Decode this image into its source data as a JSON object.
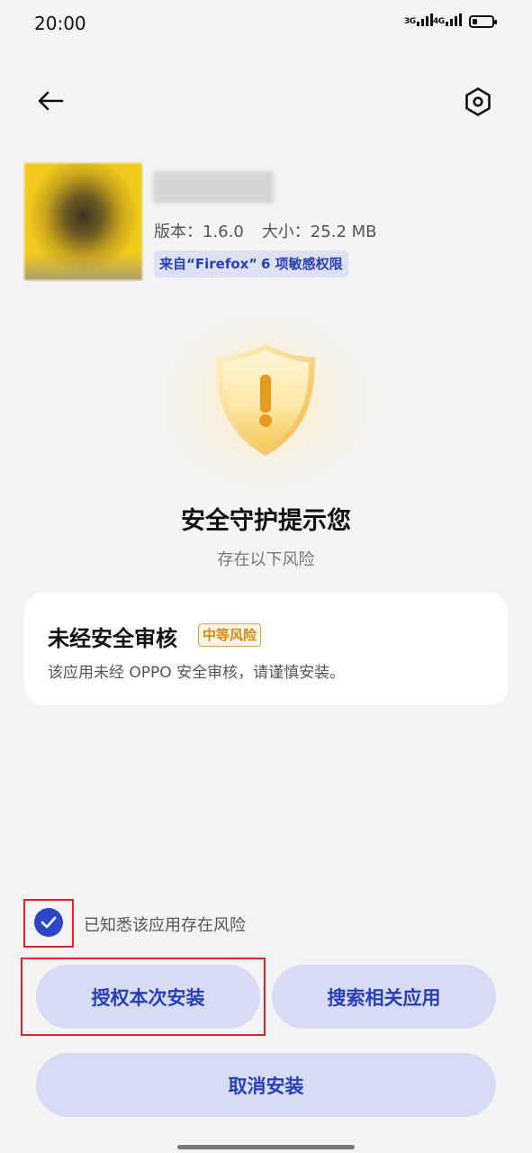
{
  "status_bar": {
    "time": "20:00",
    "network_1": "3G",
    "network_2": "4G"
  },
  "header": {
    "back_icon": "arrow-left-icon",
    "settings_icon": "hexagon-gear-icon"
  },
  "app": {
    "version_label": "版本：1.6.0",
    "size_label": "大小：25.2 MB",
    "tags": [
      "来自“Firefox”",
      "6 项敏感权限"
    ]
  },
  "warning": {
    "icon": "shield-exclamation-icon",
    "title": "安全守护提示您",
    "subtitle": "存在以下风险"
  },
  "risk": {
    "title": "未经安全审核",
    "badge": "中等风险",
    "description": "该应用未经 OPPO 安全审核，请谨慎安装。"
  },
  "acknowledge": {
    "label": "已知悉该应用存在风险",
    "checked": true
  },
  "actions": {
    "allow_label": "授权本次安装",
    "search_label": "搜索相关应用",
    "cancel_label": "取消安装"
  },
  "colors": {
    "accent": "#2c46c8",
    "button_bg": "#d7dbf3",
    "risk_orange": "#d98a12",
    "highlight_red": "#e0262a",
    "background": "#f4f4f4"
  }
}
